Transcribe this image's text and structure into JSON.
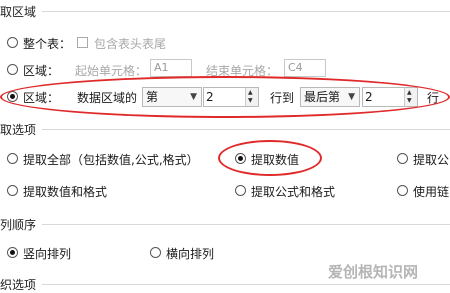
{
  "region": {
    "title": "取区域",
    "whole_table": "整个表：",
    "include_header": "包含表头表尾",
    "area_label": "区域：",
    "start_cell_label": "起始单元格：",
    "start_cell_value": "A1",
    "end_cell_label": "结束单元格：",
    "end_cell_value": "C4",
    "data_area_of": "数据区域的",
    "first_select": "第",
    "first_num": "2",
    "row_to": "行到",
    "last_select": "最后第",
    "last_num": "2",
    "row_suffix": "行"
  },
  "options": {
    "title": "取选项",
    "extract_all": "提取全部（包括数值,公式,格式）",
    "extract_values": "提取数值",
    "extract_formula_partial": "提取公",
    "extract_values_format": "提取数值和格式",
    "extract_formula_format": "提取公式和格式",
    "use_link_partial": "使用链"
  },
  "order": {
    "title": "列顺序",
    "vertical": "竖向排列",
    "horizontal": "横向排列"
  },
  "bottom": {
    "title_partial": "织选项"
  },
  "watermark": "爱创根知识网"
}
